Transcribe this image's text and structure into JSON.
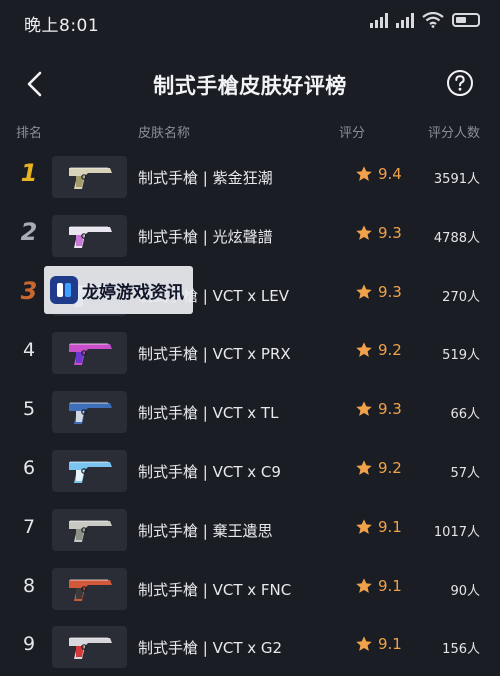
{
  "status": {
    "time": "晚上8:01",
    "battery_percent": 60
  },
  "header": {
    "title": "制式手槍皮肤好评榜",
    "back_icon": "chevron-left-icon",
    "help_icon": "question-circle-icon"
  },
  "columns": {
    "rank": "排名",
    "name": "皮肤名称",
    "score": "评分",
    "count": "评分人数"
  },
  "watermark": {
    "text": "龙婷游戏资讯"
  },
  "colors": {
    "accent_star": "#f0a24a",
    "rank_gold": "#e8b320",
    "rank_silver": "#a9acb4",
    "rank_bronze": "#c8682f"
  },
  "rows": [
    {
      "rank": "1",
      "name": "制式手槍 | 紫金狂潮",
      "score": "9.4",
      "count": "3591人",
      "skin_color": "#d8d3b8",
      "accent": "#a39b6a"
    },
    {
      "rank": "2",
      "name": "制式手槍 | 光炫聲譜",
      "score": "9.3",
      "count": "4788人",
      "skin_color": "#e9e6ef",
      "accent": "#c77ad8"
    },
    {
      "rank": "3",
      "name": "制式手槍 | VCT x LEV",
      "score": "9.3",
      "count": "270人",
      "skin_color": "#bfc3c9",
      "accent": "#7ab8c8"
    },
    {
      "rank": "4",
      "name": "制式手槍 | VCT x PRX",
      "score": "9.2",
      "count": "519人",
      "skin_color": "#c94ec9",
      "accent": "#6d3ad0"
    },
    {
      "rank": "5",
      "name": "制式手槍 | VCT x TL",
      "score": "9.3",
      "count": "66人",
      "skin_color": "#3f6fb8",
      "accent": "#cfd6e4"
    },
    {
      "rank": "6",
      "name": "制式手槍 | VCT x C9",
      "score": "9.2",
      "count": "57人",
      "skin_color": "#7ac4ef",
      "accent": "#e8f2fa"
    },
    {
      "rank": "7",
      "name": "制式手槍 | 棄王遺思",
      "score": "9.1",
      "count": "1017人",
      "skin_color": "#c7c9c2",
      "accent": "#8e9186"
    },
    {
      "rank": "8",
      "name": "制式手槍 | VCT x FNC",
      "score": "9.1",
      "count": "90人",
      "skin_color": "#d2583a",
      "accent": "#3a3a3a"
    },
    {
      "rank": "9",
      "name": "制式手槍 | VCT x G2",
      "score": "9.1",
      "count": "156人",
      "skin_color": "#d8d8dc",
      "accent": "#d23a3a"
    }
  ]
}
